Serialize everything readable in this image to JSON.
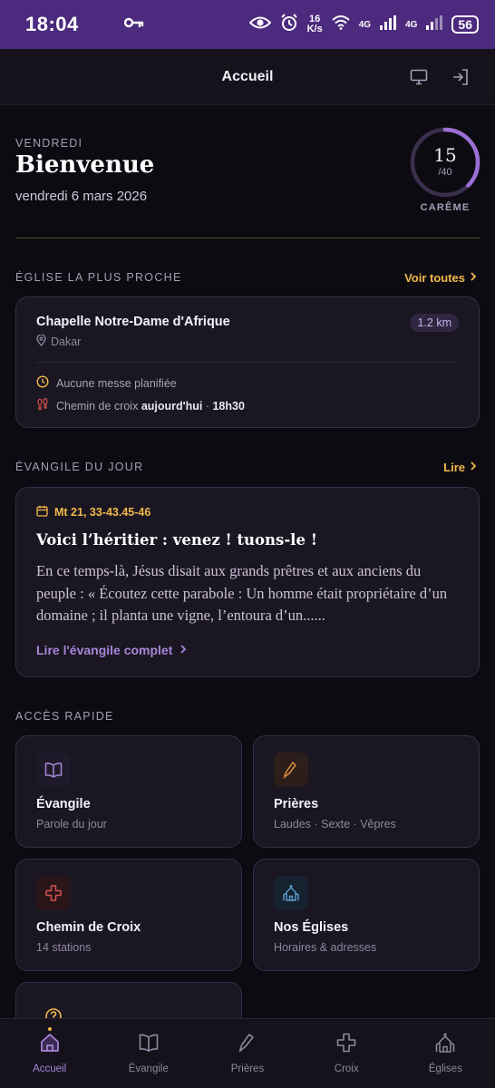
{
  "status_bar": {
    "time": "18:04",
    "net_speed_top": "16",
    "net_speed_bottom": "K/s",
    "signal1": "4G",
    "signal2": "4G",
    "battery": "56"
  },
  "header": {
    "title": "Accueil",
    "icons": [
      "monitor-icon",
      "login-icon"
    ]
  },
  "greeting": {
    "day": "VENDREDI",
    "title": "Bienvenue",
    "date": "vendredi 6 mars 2026",
    "lent_day": "15",
    "lent_total": "/40",
    "lent_progress": 0.375,
    "lent_label": "CARÊME"
  },
  "nearest": {
    "section_title": "ÉGLISE LA PLUS PROCHE",
    "link": "Voir toutes",
    "church_name": "Chapelle Notre-Dame d'Afrique",
    "distance": "1.2 km",
    "location": "Dakar",
    "mass_info": "Aucune messe planifiée",
    "way_prefix": "Chemin de croix",
    "way_when": "aujourd'hui",
    "way_sep": " · ",
    "way_time": "18h30"
  },
  "gospel": {
    "section_title": "ÉVANGILE DU JOUR",
    "link": "Lire",
    "reference": "Mt 21, 33-43.45-46",
    "title": "Voici l’héritier : venez ! tuons-le !",
    "excerpt": "En ce temps-là, Jésus disait aux grands prêtres et aux anciens du peuple : « Écoutez cette parabole : Un homme était propriétaire d’un domaine ; il planta une vigne, l’entoura d’un......",
    "read_full": "Lire l'évangile complet"
  },
  "quick_access": {
    "section_title": "ACCÈS RAPIDE",
    "items": [
      {
        "title": "Évangile",
        "subtitle": "Parole du jour",
        "icon": "book-icon",
        "color": "#a986d8"
      },
      {
        "title": "Prières",
        "subtitle": "Laudes · Sexte · Vêpres",
        "icon": "praying-hands-icon",
        "color": "#e08a3c"
      },
      {
        "title": "Chemin de Croix",
        "subtitle": "14 stations",
        "icon": "cross-icon",
        "color": "#d6524f"
      },
      {
        "title": "Nos Églises",
        "subtitle": "Horaires & adresses",
        "icon": "church-icon",
        "color": "#5e9fcf"
      },
      {
        "icon": "help-icon",
        "color": "#f1b84a"
      }
    ]
  },
  "bottom_nav": {
    "items": [
      {
        "label": "Accueil",
        "icon": "home-icon"
      },
      {
        "label": "Évangile",
        "icon": "book-icon"
      },
      {
        "label": "Prières",
        "icon": "praying-hands-icon"
      },
      {
        "label": "Croix",
        "icon": "cross-icon"
      },
      {
        "label": "Églises",
        "icon": "church-icon"
      }
    ],
    "active": "Accueil"
  },
  "colors": {
    "status_bar": "#4c2a7e",
    "accent_purple": "#a986d8",
    "accent_gold": "#f1b84a",
    "background": "#0d0b12"
  }
}
